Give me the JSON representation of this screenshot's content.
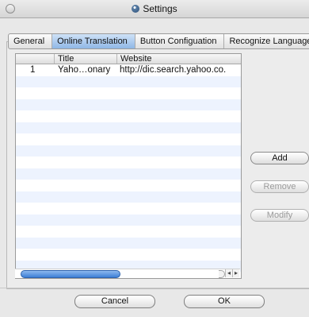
{
  "window": {
    "title": "Settings"
  },
  "tabs": [
    {
      "label": "General"
    },
    {
      "label": "Online Translation"
    },
    {
      "label": "Button Configuation"
    },
    {
      "label": "Recognize Language"
    }
  ],
  "table": {
    "columns": [
      "",
      "Title",
      "Website"
    ],
    "rows": [
      {
        "index": "1",
        "title": "Yaho…onary",
        "website": "http://dic.search.yahoo.co."
      }
    ]
  },
  "side_buttons": {
    "add": "Add",
    "remove": "Remove",
    "modify": "Modify"
  },
  "footer": {
    "cancel": "Cancel",
    "ok": "OK"
  },
  "icons": {
    "window_icon": "settings-globe-icon",
    "scroll_left": "◂",
    "scroll_right": "▸"
  },
  "colors": {
    "active_tab": "#8fb7e6",
    "stripe": "#edf3fe",
    "scroll_thumb": "#3d7fd6"
  }
}
